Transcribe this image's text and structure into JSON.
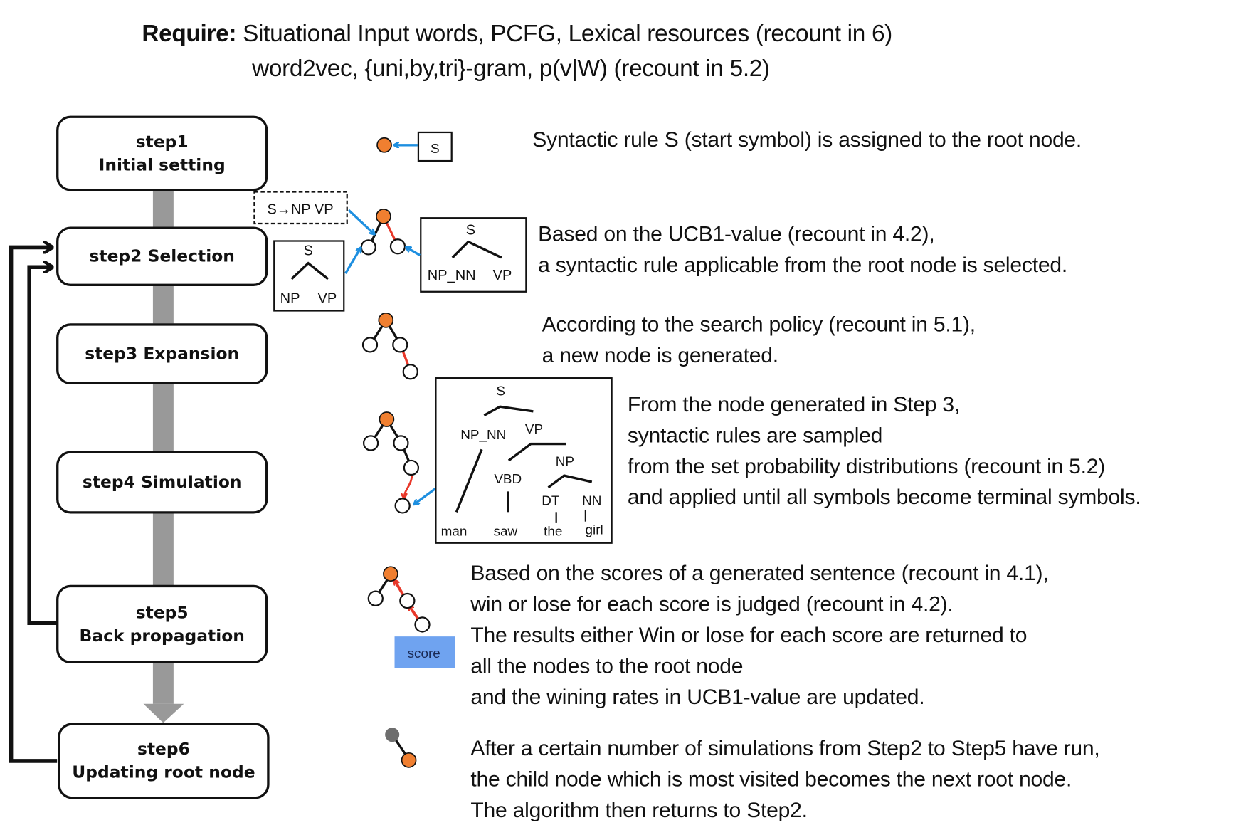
{
  "header": {
    "require_label": "Require:",
    "line1": "Situational Input words, PCFG, Lexical resources (recount in 6)",
    "line2": "word2vec, {uni,by,tri}-gram, p(v|W) (recount in 5.2)"
  },
  "steps": [
    {
      "id": "step1",
      "line1": "step1",
      "line2": "Initial setting"
    },
    {
      "id": "step2",
      "line1": "step2  Selection",
      "line2": ""
    },
    {
      "id": "step3",
      "line1": "step3  Expansion",
      "line2": ""
    },
    {
      "id": "step4",
      "line1": "step4  Simulation",
      "line2": ""
    },
    {
      "id": "step5",
      "line1": "step5",
      "line2": "Back propagation"
    },
    {
      "id": "step6",
      "line1": "step6",
      "line2": "Updating root node"
    }
  ],
  "descriptions": {
    "step1": [
      "Syntactic rule S (start symbol) is assigned to the root node."
    ],
    "step2": [
      "Based on the UCB1-value (recount in 4.2),",
      "a syntactic rule applicable from the root node is selected."
    ],
    "step3": [
      "According to the search policy (recount in 5.1),",
      "a new node is generated."
    ],
    "step4": [
      "From the node generated in Step 3,",
      "syntactic rules are sampled",
      "from  the set probability distributions (recount in 5.2)",
      "and applied until all symbols become terminal symbols."
    ],
    "step5": [
      "Based on the scores of a generated sentence (recount in 4.1),",
      "win or lose for each score is judged (recount in 4.2).",
      "The results either Win or lose for each score are returned to",
      "all the nodes to the root node",
      "and the wining rates in UCB1-value are updated."
    ],
    "step6": [
      "After a certain number of simulations from Step2 to Step5 have run,",
      "the child node which is most visited becomes the next root node.",
      "The algorithm then returns to Step2."
    ]
  },
  "labels": {
    "start_symbol": "S",
    "rule_dashed": "S→NP VP",
    "rule_np_vp": {
      "root": "S",
      "left": "NP",
      "right": "VP"
    },
    "rule_npnn_vp": {
      "root": "S",
      "left": "NP_NN",
      "right": "VP"
    },
    "parse_tree": {
      "S": "S",
      "NP_NN": "NP_NN",
      "VP": "VP",
      "VBD": "VBD",
      "NP": "NP",
      "DT": "DT",
      "NN": "NN",
      "words": [
        "man",
        "saw",
        "the",
        "girl"
      ]
    },
    "score": "score"
  },
  "colors": {
    "node_active": "#f07f30",
    "node_gray": "#6e6e6e",
    "arrow_blue": "#1e8fe0",
    "edge_red": "#e8382a",
    "score_bg": "#6fa3f0",
    "flow_gray": "#999999"
  }
}
